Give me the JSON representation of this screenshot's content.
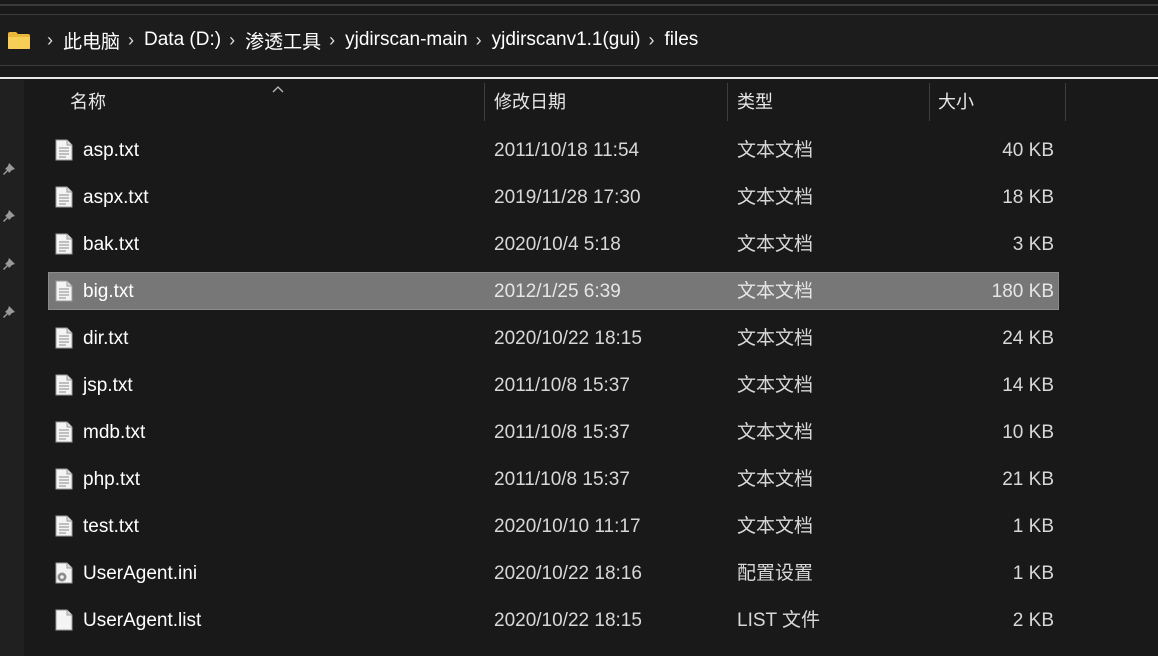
{
  "breadcrumb": {
    "items": [
      "此电脑",
      "Data (D:)",
      "渗透工具",
      "yjdirscan-main",
      "yjdirscanv1.1(gui)",
      "files"
    ]
  },
  "columns": {
    "name": "名称",
    "date": "修改日期",
    "type": "类型",
    "size": "大小"
  },
  "files": [
    {
      "name": "asp.txt",
      "date": "2011/10/18 11:54",
      "type": "文本文档",
      "size": "40 KB",
      "icon": "text-file-icon"
    },
    {
      "name": "aspx.txt",
      "date": "2019/11/28 17:30",
      "type": "文本文档",
      "size": "18 KB",
      "icon": "text-file-icon"
    },
    {
      "name": "bak.txt",
      "date": "2020/10/4 5:18",
      "type": "文本文档",
      "size": "3 KB",
      "icon": "text-file-icon"
    },
    {
      "name": "big.txt",
      "date": "2012/1/25 6:39",
      "type": "文本文档",
      "size": "180 KB",
      "icon": "text-file-icon",
      "selected": true
    },
    {
      "name": "dir.txt",
      "date": "2020/10/22 18:15",
      "type": "文本文档",
      "size": "24 KB",
      "icon": "text-file-icon"
    },
    {
      "name": "jsp.txt",
      "date": "2011/10/8 15:37",
      "type": "文本文档",
      "size": "14 KB",
      "icon": "text-file-icon"
    },
    {
      "name": "mdb.txt",
      "date": "2011/10/8 15:37",
      "type": "文本文档",
      "size": "10 KB",
      "icon": "text-file-icon"
    },
    {
      "name": "php.txt",
      "date": "2011/10/8 15:37",
      "type": "文本文档",
      "size": "21 KB",
      "icon": "text-file-icon"
    },
    {
      "name": "test.txt",
      "date": "2020/10/10 11:17",
      "type": "文本文档",
      "size": "1 KB",
      "icon": "text-file-icon"
    },
    {
      "name": "UserAgent.ini",
      "date": "2020/10/22 18:16",
      "type": "配置设置",
      "size": "1 KB",
      "icon": "settings-file-icon"
    },
    {
      "name": "UserAgent.list",
      "date": "2020/10/22 18:15",
      "type": "LIST 文件",
      "size": "2 KB",
      "icon": "blank-file-icon"
    }
  ],
  "colors": {
    "background": "#191919",
    "selection": "#777777",
    "folder": "#f3c64a"
  }
}
